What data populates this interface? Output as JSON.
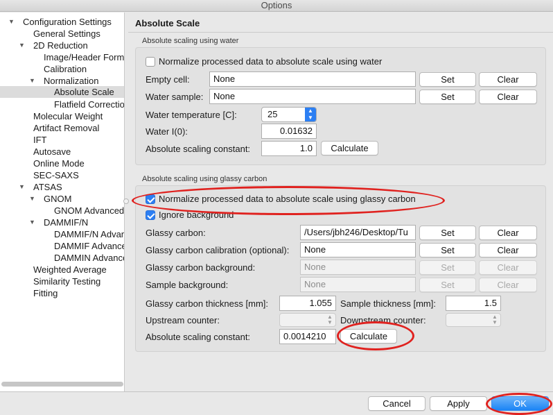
{
  "window": {
    "title": "Options"
  },
  "sidebar": {
    "items": [
      {
        "label": "Configuration Settings",
        "expanded": true
      },
      {
        "label": "General Settings"
      },
      {
        "label": "2D Reduction",
        "expanded": true
      },
      {
        "label": "Image/Header Format"
      },
      {
        "label": "Calibration"
      },
      {
        "label": "Normalization",
        "expanded": true
      },
      {
        "label": "Absolute Scale",
        "selected": true
      },
      {
        "label": "Flatfield Correction"
      },
      {
        "label": "Molecular Weight"
      },
      {
        "label": "Artifact Removal"
      },
      {
        "label": "IFT"
      },
      {
        "label": "Autosave"
      },
      {
        "label": "Online Mode"
      },
      {
        "label": "SEC-SAXS"
      },
      {
        "label": "ATSAS",
        "expanded": true
      },
      {
        "label": "GNOM",
        "expanded": true
      },
      {
        "label": "GNOM Advanced"
      },
      {
        "label": "DAMMIF/N",
        "expanded": true
      },
      {
        "label": "DAMMIF/N Advanced"
      },
      {
        "label": "DAMMIF Advanced"
      },
      {
        "label": "DAMMIN Advanced"
      },
      {
        "label": "Weighted Average"
      },
      {
        "label": "Similarity Testing"
      },
      {
        "label": "Fitting"
      }
    ]
  },
  "page": {
    "title": "Absolute Scale"
  },
  "water": {
    "group_label": "Absolute scaling using water",
    "normalize_label": "Normalize processed data to absolute scale using water",
    "normalize_checked": false,
    "empty_cell_label": "Empty cell:",
    "empty_cell_value": "None",
    "water_sample_label": "Water sample:",
    "water_sample_value": "None",
    "set_label": "Set",
    "clear_label": "Clear",
    "temperature_label": "Water temperature [C]:",
    "temperature_value": "25",
    "water_i0_label": "Water I(0):",
    "water_i0_value": "0.01632",
    "constant_label": "Absolute scaling constant:",
    "constant_value": "1.0",
    "calculate_label": "Calculate"
  },
  "glassy": {
    "group_label": "Absolute scaling using glassy carbon",
    "normalize_label": "Normalize processed data to absolute scale using glassy carbon",
    "normalize_checked": true,
    "ignore_bg_label": "Ignore background",
    "ignore_bg_checked": true,
    "carbon_label": "Glassy carbon:",
    "carbon_value": "/Users/jbh246/Desktop/Tu",
    "calibration_label": "Glassy carbon calibration (optional):",
    "calibration_value": "None",
    "background_label": "Glassy carbon background:",
    "background_value": "None",
    "sample_bg_label": "Sample background:",
    "sample_bg_value": "None",
    "set_label": "Set",
    "clear_label": "Clear",
    "thickness_label": "Glassy carbon thickness [mm]:",
    "thickness_value": "1.055",
    "sample_thickness_label": "Sample thickness [mm]:",
    "sample_thickness_value": "1.5",
    "upstream_label": "Upstream counter:",
    "downstream_label": "Downstream counter:",
    "constant_label": "Absolute scaling constant:",
    "constant_value": "0.0014210",
    "calculate_label": "Calculate"
  },
  "footer": {
    "cancel_label": "Cancel",
    "apply_label": "Apply",
    "ok_label": "OK"
  },
  "colors": {
    "annotation": "#e0221f",
    "accent": "#2c7ff3"
  }
}
